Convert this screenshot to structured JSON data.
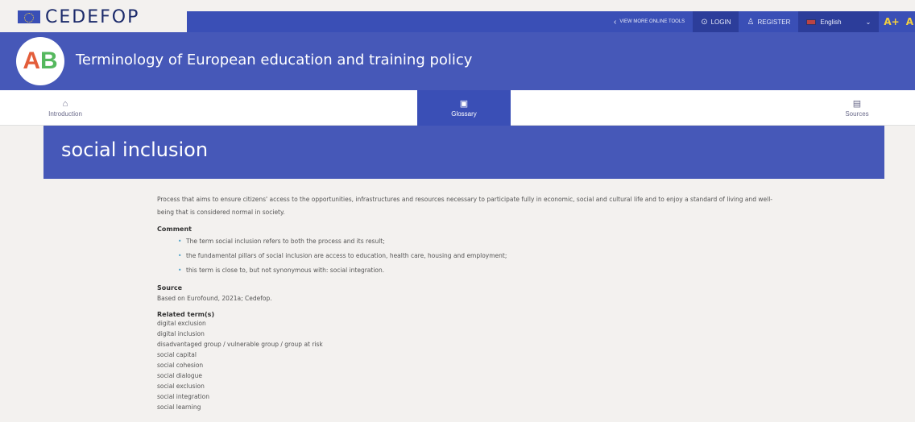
{
  "topbar": {
    "logo_text": "CEDEFOP",
    "view_tools": "VIEW MORE ONLINE TOOLS",
    "login": "LOGIN",
    "register": "REGISTER",
    "language": "English",
    "font_increase": "A+",
    "font_more": "A"
  },
  "header": {
    "logo_a": "A",
    "logo_b": "B",
    "title": "Terminology of European education and training policy"
  },
  "nav": {
    "introduction": "Introduction",
    "glossary": "Glossary",
    "sources": "Sources"
  },
  "term": {
    "title": "social inclusion",
    "definition": "Process that aims to ensure citizens' access to the opportunities, infrastructures and resources necessary to participate fully in economic, social and cultural life and to enjoy a standard of living and well-being that is considered normal in society.",
    "comment_label": "Comment",
    "comments": [
      "The term social inclusion refers to both the process and its result;",
      "the fundamental pillars of social inclusion are access to education, health care, housing and employment;",
      "this term is close to, but not synonymous with: social integration."
    ],
    "source_label": "Source",
    "source": "Based on Eurofound, 2021a; Cedefop.",
    "related_label": "Related term(s)",
    "related": [
      "digital exclusion",
      "digital inclusion",
      "disadvantaged group / vulnerable group / group at risk",
      "social capital",
      "social cohesion",
      "social dialogue",
      "social exclusion",
      "social integration",
      "social learning"
    ]
  },
  "colors": {
    "brand_blue": "#4658b8",
    "dark_blue": "#3a4fb6",
    "accent_yellow": "#f4d03f"
  }
}
